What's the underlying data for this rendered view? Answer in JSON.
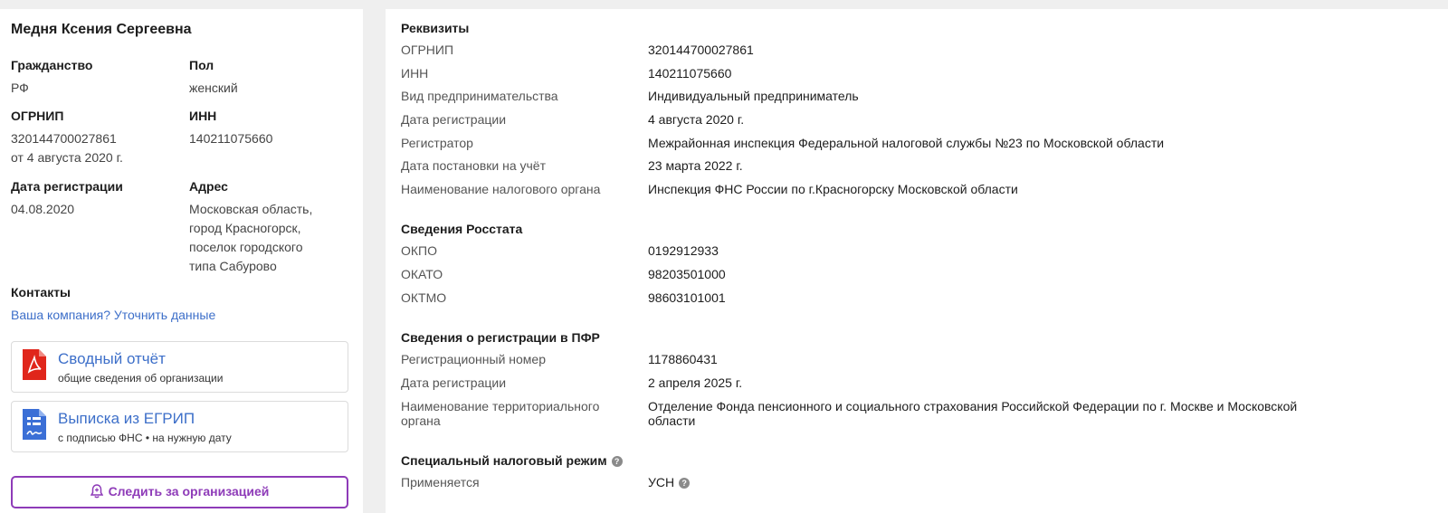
{
  "left": {
    "name": "Медня Ксения Сергеевна",
    "citizenship": {
      "label": "Гражданство",
      "value": "РФ"
    },
    "sex": {
      "label": "Пол",
      "value": "женский"
    },
    "ogrnip": {
      "label": "ОГРНИП",
      "value": "320144700027861",
      "date": "от 4 августа 2020 г."
    },
    "inn": {
      "label": "ИНН",
      "value": "140211075660"
    },
    "reg_date": {
      "label": "Дата регистрации",
      "value": "04.08.2020"
    },
    "address": {
      "label": "Адрес",
      "lines": [
        "Московская область,",
        "город Красногорск,",
        "поселок городского",
        "типа Сабурово"
      ]
    },
    "contacts": {
      "label": "Контакты",
      "link": "Ваша компания? Уточнить данные"
    },
    "docs": [
      {
        "title": "Сводный отчёт",
        "subtitle": "общие сведения об организации",
        "icon": "pdf-icon"
      },
      {
        "title": "Выписка из ЕГРИП",
        "subtitle": "с подписью ФНС • на нужную дату",
        "icon": "document-icon"
      }
    ],
    "follow_button": "Следить за организацией"
  },
  "right": {
    "requisites": {
      "title": "Реквизиты",
      "rows": [
        {
          "label": "ОГРНИП",
          "value": "320144700027861"
        },
        {
          "label": "ИНН",
          "value": "140211075660"
        },
        {
          "label": "Вид предпринимательства",
          "value": "Индивидуальный предприниматель"
        },
        {
          "label": "Дата регистрации",
          "value": "4 августа 2020 г."
        },
        {
          "label": "Регистратор",
          "value": "Межрайонная инспекция Федеральной налоговой службы №23 по Московской области"
        },
        {
          "label": "Дата постановки на учёт",
          "value": "23 марта 2022 г."
        },
        {
          "label": "Наименование налогового органа",
          "value": "Инспекция ФНС России по г.Красногорску Московской области"
        }
      ]
    },
    "rosstat": {
      "title": "Сведения Росстата",
      "rows": [
        {
          "label": "ОКПО",
          "value": "0192912933"
        },
        {
          "label": "ОКАТО",
          "value": "98203501000"
        },
        {
          "label": "ОКТМО",
          "value": "98603101001"
        }
      ]
    },
    "pfr": {
      "title": "Сведения о регистрации в ПФР",
      "rows": [
        {
          "label": "Регистрационный номер",
          "value": "1178860431"
        },
        {
          "label": "Дата регистрации",
          "value": "2 апреля 2025 г."
        },
        {
          "label_lines": [
            "Наименование территориального",
            "органа"
          ],
          "value_lines": [
            "Отделение Фонда пенсионного и социального страхования Российской Федерации по г. Москве и Московской",
            "области"
          ]
        }
      ]
    },
    "tax_regime": {
      "title": "Специальный налоговый режим",
      "help": "?",
      "rows": [
        {
          "label": "Применяется",
          "value": "УСН",
          "help": "?"
        }
      ]
    }
  },
  "colors": {
    "link": "#3d6fc9",
    "accent": "#8e3bb8",
    "pdf": "#e0261b",
    "doc": "#3b6fd6"
  }
}
